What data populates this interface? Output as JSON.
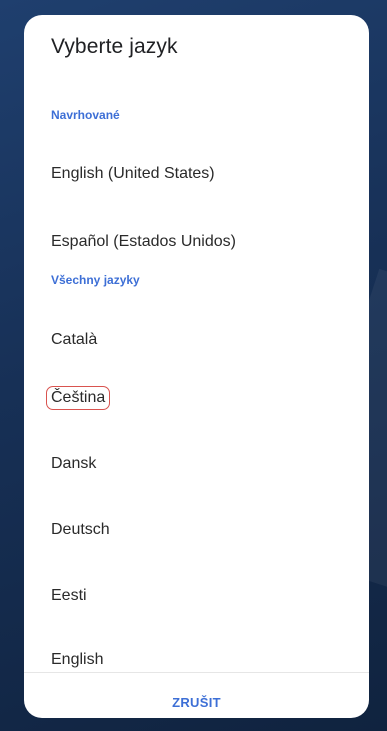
{
  "dialog": {
    "title": "Vyberte jazyk",
    "suggested_label": "Navrhované",
    "suggested": [
      "English (United States)",
      "Español (Estados Unidos)"
    ],
    "all_label": "Všechny jazyky",
    "all": [
      "Català",
      "Čeština",
      "Dansk",
      "Deutsch",
      "Eesti",
      "English"
    ],
    "cancel_label": "ZRUŠIT"
  },
  "colors": {
    "accent": "#3d6fd6",
    "highlight_border": "#d9534f",
    "background": "#173056"
  }
}
